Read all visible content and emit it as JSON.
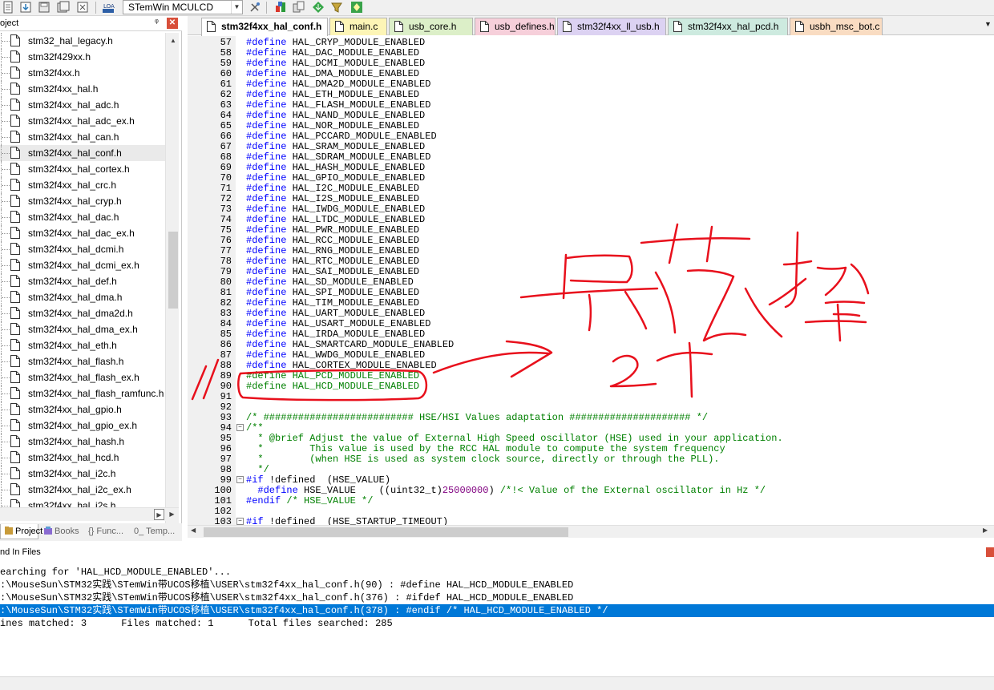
{
  "toolbar": {
    "target_name": "STemWin MCULCD"
  },
  "project_panel": {
    "title": "oject",
    "pin_glyph": "ᵠ",
    "close_glyph": "✕",
    "selected_file": "stm32f4xx_hal_conf.h",
    "files": [
      "stm32_hal_legacy.h",
      "stm32f429xx.h",
      "stm32f4xx.h",
      "stm32f4xx_hal.h",
      "stm32f4xx_hal_adc.h",
      "stm32f4xx_hal_adc_ex.h",
      "stm32f4xx_hal_can.h",
      "stm32f4xx_hal_conf.h",
      "stm32f4xx_hal_cortex.h",
      "stm32f4xx_hal_crc.h",
      "stm32f4xx_hal_cryp.h",
      "stm32f4xx_hal_dac.h",
      "stm32f4xx_hal_dac_ex.h",
      "stm32f4xx_hal_dcmi.h",
      "stm32f4xx_hal_dcmi_ex.h",
      "stm32f4xx_hal_def.h",
      "stm32f4xx_hal_dma.h",
      "stm32f4xx_hal_dma2d.h",
      "stm32f4xx_hal_dma_ex.h",
      "stm32f4xx_hal_eth.h",
      "stm32f4xx_hal_flash.h",
      "stm32f4xx_hal_flash_ex.h",
      "stm32f4xx_hal_flash_ramfunc.h",
      "stm32f4xx_hal_gpio.h",
      "stm32f4xx_hal_gpio_ex.h",
      "stm32f4xx_hal_hash.h",
      "stm32f4xx_hal_hcd.h",
      "stm32f4xx_hal_i2c.h",
      "stm32f4xx_hal_i2c_ex.h",
      "stm32f4xx_hal_i2s.h"
    ],
    "tabs": [
      {
        "label": "Project",
        "active": true
      },
      {
        "label": "Books",
        "active": false
      },
      {
        "label": "{} Func...",
        "active": false
      },
      {
        "label": "0_ Temp...",
        "active": false
      }
    ]
  },
  "editor_tabs": [
    {
      "label": "stm32f4xx_hal_conf.h",
      "active": true,
      "color": "#ffffff"
    },
    {
      "label": "main.c",
      "active": false,
      "color": "#fdf5b6"
    },
    {
      "label": "usb_core.h",
      "active": false,
      "color": "#dcefc8"
    },
    {
      "label": "usb_defines.h",
      "active": false,
      "color": "#f6cfda"
    },
    {
      "label": "stm32f4xx_ll_usb.h",
      "active": false,
      "color": "#dcd2f2"
    },
    {
      "label": "stm32f4xx_hal_pcd.h",
      "active": false,
      "color": "#cdeadf"
    },
    {
      "label": "usbh_msc_bot.c",
      "active": false,
      "color": "#f9dcc2"
    }
  ],
  "editor": {
    "lines": [
      {
        "n": "57",
        "segs": [
          [
            "d",
            "#define "
          ],
          [
            "t",
            "HAL_CRYP_MODULE_ENABLED"
          ]
        ]
      },
      {
        "n": "58",
        "segs": [
          [
            "d",
            "#define "
          ],
          [
            "t",
            "HAL_DAC_MODULE_ENABLED"
          ]
        ]
      },
      {
        "n": "59",
        "segs": [
          [
            "d",
            "#define "
          ],
          [
            "t",
            "HAL_DCMI_MODULE_ENABLED"
          ]
        ]
      },
      {
        "n": "60",
        "segs": [
          [
            "d",
            "#define "
          ],
          [
            "t",
            "HAL_DMA_MODULE_ENABLED"
          ]
        ]
      },
      {
        "n": "61",
        "segs": [
          [
            "d",
            "#define "
          ],
          [
            "t",
            "HAL_DMA2D_MODULE_ENABLED"
          ]
        ]
      },
      {
        "n": "62",
        "segs": [
          [
            "d",
            "#define "
          ],
          [
            "t",
            "HAL_ETH_MODULE_ENABLED"
          ]
        ]
      },
      {
        "n": "63",
        "segs": [
          [
            "d",
            "#define "
          ],
          [
            "t",
            "HAL_FLASH_MODULE_ENABLED"
          ]
        ]
      },
      {
        "n": "64",
        "segs": [
          [
            "d",
            "#define "
          ],
          [
            "t",
            "HAL_NAND_MODULE_ENABLED"
          ]
        ]
      },
      {
        "n": "65",
        "segs": [
          [
            "d",
            "#define "
          ],
          [
            "t",
            "HAL_NOR_MODULE_ENABLED"
          ]
        ]
      },
      {
        "n": "66",
        "segs": [
          [
            "d",
            "#define "
          ],
          [
            "t",
            "HAL_PCCARD_MODULE_ENABLED"
          ]
        ]
      },
      {
        "n": "67",
        "segs": [
          [
            "d",
            "#define "
          ],
          [
            "t",
            "HAL_SRAM_MODULE_ENABLED"
          ]
        ]
      },
      {
        "n": "68",
        "segs": [
          [
            "d",
            "#define "
          ],
          [
            "t",
            "HAL_SDRAM_MODULE_ENABLED"
          ]
        ]
      },
      {
        "n": "69",
        "segs": [
          [
            "d",
            "#define "
          ],
          [
            "t",
            "HAL_HASH_MODULE_ENABLED"
          ]
        ]
      },
      {
        "n": "70",
        "segs": [
          [
            "d",
            "#define "
          ],
          [
            "t",
            "HAL_GPIO_MODULE_ENABLED"
          ]
        ]
      },
      {
        "n": "71",
        "segs": [
          [
            "d",
            "#define "
          ],
          [
            "t",
            "HAL_I2C_MODULE_ENABLED"
          ]
        ]
      },
      {
        "n": "72",
        "segs": [
          [
            "d",
            "#define "
          ],
          [
            "t",
            "HAL_I2S_MODULE_ENABLED"
          ]
        ]
      },
      {
        "n": "73",
        "segs": [
          [
            "d",
            "#define "
          ],
          [
            "t",
            "HAL_IWDG_MODULE_ENABLED"
          ]
        ]
      },
      {
        "n": "74",
        "segs": [
          [
            "d",
            "#define "
          ],
          [
            "t",
            "HAL_LTDC_MODULE_ENABLED"
          ]
        ]
      },
      {
        "n": "75",
        "segs": [
          [
            "d",
            "#define "
          ],
          [
            "t",
            "HAL_PWR_MODULE_ENABLED"
          ]
        ]
      },
      {
        "n": "76",
        "segs": [
          [
            "d",
            "#define "
          ],
          [
            "t",
            "HAL_RCC_MODULE_ENABLED"
          ]
        ]
      },
      {
        "n": "77",
        "segs": [
          [
            "d",
            "#define "
          ],
          [
            "t",
            "HAL_RNG_MODULE_ENABLED"
          ]
        ]
      },
      {
        "n": "78",
        "segs": [
          [
            "d",
            "#define "
          ],
          [
            "t",
            "HAL_RTC_MODULE_ENABLED"
          ]
        ]
      },
      {
        "n": "79",
        "segs": [
          [
            "d",
            "#define "
          ],
          [
            "t",
            "HAL_SAI_MODULE_ENABLED"
          ]
        ]
      },
      {
        "n": "80",
        "segs": [
          [
            "d",
            "#define "
          ],
          [
            "t",
            "HAL_SD_MODULE_ENABLED"
          ]
        ]
      },
      {
        "n": "81",
        "segs": [
          [
            "d",
            "#define "
          ],
          [
            "t",
            "HAL_SPI_MODULE_ENABLED"
          ]
        ]
      },
      {
        "n": "82",
        "segs": [
          [
            "d",
            "#define "
          ],
          [
            "t",
            "HAL_TIM_MODULE_ENABLED"
          ]
        ]
      },
      {
        "n": "83",
        "segs": [
          [
            "d",
            "#define "
          ],
          [
            "t",
            "HAL_UART_MODULE_ENABLED"
          ]
        ]
      },
      {
        "n": "84",
        "segs": [
          [
            "d",
            "#define "
          ],
          [
            "t",
            "HAL_USART_MODULE_ENABLED"
          ]
        ]
      },
      {
        "n": "85",
        "segs": [
          [
            "d",
            "#define "
          ],
          [
            "t",
            "HAL_IRDA_MODULE_ENABLED"
          ]
        ]
      },
      {
        "n": "86",
        "segs": [
          [
            "d",
            "#define "
          ],
          [
            "t",
            "HAL_SMARTCARD_MODULE_ENABLED"
          ]
        ]
      },
      {
        "n": "87",
        "segs": [
          [
            "d",
            "#define "
          ],
          [
            "t",
            "HAL_WWDG_MODULE_ENABLED"
          ]
        ]
      },
      {
        "n": "88",
        "segs": [
          [
            "d",
            "#define "
          ],
          [
            "t",
            "HAL_CORTEX_MODULE_ENABLED"
          ]
        ]
      },
      {
        "n": "89",
        "segs": [
          [
            "c",
            "#define HAL_PCD_MODULE_ENABLED"
          ]
        ]
      },
      {
        "n": "90",
        "segs": [
          [
            "c",
            "#define HAL_HCD_MODULE_ENABLED"
          ]
        ]
      },
      {
        "n": "91",
        "segs": []
      },
      {
        "n": "92",
        "segs": []
      },
      {
        "n": "93",
        "segs": [
          [
            "c",
            "/* ########################## HSE/HSI Values adaptation ##################### */"
          ]
        ]
      },
      {
        "n": "94",
        "fold": "⊟",
        "segs": [
          [
            "c",
            "/**"
          ]
        ]
      },
      {
        "n": "95",
        "segs": [
          [
            "c",
            "  * @brief Adjust the value of External High Speed oscillator (HSE) used in your application."
          ]
        ]
      },
      {
        "n": "96",
        "segs": [
          [
            "c",
            "  *        This value is used by the RCC HAL module to compute the system frequency"
          ]
        ]
      },
      {
        "n": "97",
        "segs": [
          [
            "c",
            "  *        (when HSE is used as system clock source, directly or through the PLL)."
          ]
        ]
      },
      {
        "n": "98",
        "segs": [
          [
            "c",
            "  */"
          ]
        ]
      },
      {
        "n": "99",
        "fold": "⊟",
        "segs": [
          [
            "d",
            "#if "
          ],
          [
            "t",
            "!defined  (HSE_VALUE)"
          ]
        ]
      },
      {
        "n": "100",
        "segs": [
          [
            "d",
            "  #define "
          ],
          [
            "t",
            "HSE_VALUE    ((uint32_t)"
          ],
          [
            "n",
            "25000000"
          ],
          [
            "t",
            ") "
          ],
          [
            "c",
            "/*!< Value of the External oscillator in Hz */"
          ]
        ]
      },
      {
        "n": "101",
        "segs": [
          [
            "d",
            "#endif "
          ],
          [
            "c",
            "/* HSE_VALUE */"
          ]
        ]
      },
      {
        "n": "102",
        "segs": []
      },
      {
        "n": "103",
        "fold": "⊟",
        "segs": [
          [
            "d",
            "#if "
          ],
          [
            "t",
            "!defined  (HSE_STARTUP_TIMEOUT)"
          ]
        ]
      }
    ]
  },
  "find_in_files": {
    "title": "nd In Files",
    "lines": [
      {
        "text": "earching for 'HAL_HCD_MODULE_ENABLED'...",
        "highlighted": false
      },
      {
        "text": ":\\MouseSun\\STM32实践\\STemWin带UCOS移植\\USER\\stm32f4xx_hal_conf.h(90) : #define HAL_HCD_MODULE_ENABLED",
        "highlighted": false
      },
      {
        "text": ":\\MouseSun\\STM32实践\\STemWin带UCOS移植\\USER\\stm32f4xx_hal_conf.h(376) : #ifdef HAL_HCD_MODULE_ENABLED",
        "highlighted": false
      },
      {
        "text": ":\\MouseSun\\STM32实践\\STemWin带UCOS移植\\USER\\stm32f4xx_hal_conf.h(378) : #endif /* HAL_HCD_MODULE_ENABLED */",
        "highlighted": true
      },
      {
        "text": "ines matched: 3      Files matched: 1      Total files searched: 285",
        "highlighted": false
      }
    ]
  },
  "colors": {
    "directive": "#0000ff",
    "comment": "#008000",
    "number": "#800080",
    "annotation": "#e8101c",
    "selection": "#0078d7"
  }
}
